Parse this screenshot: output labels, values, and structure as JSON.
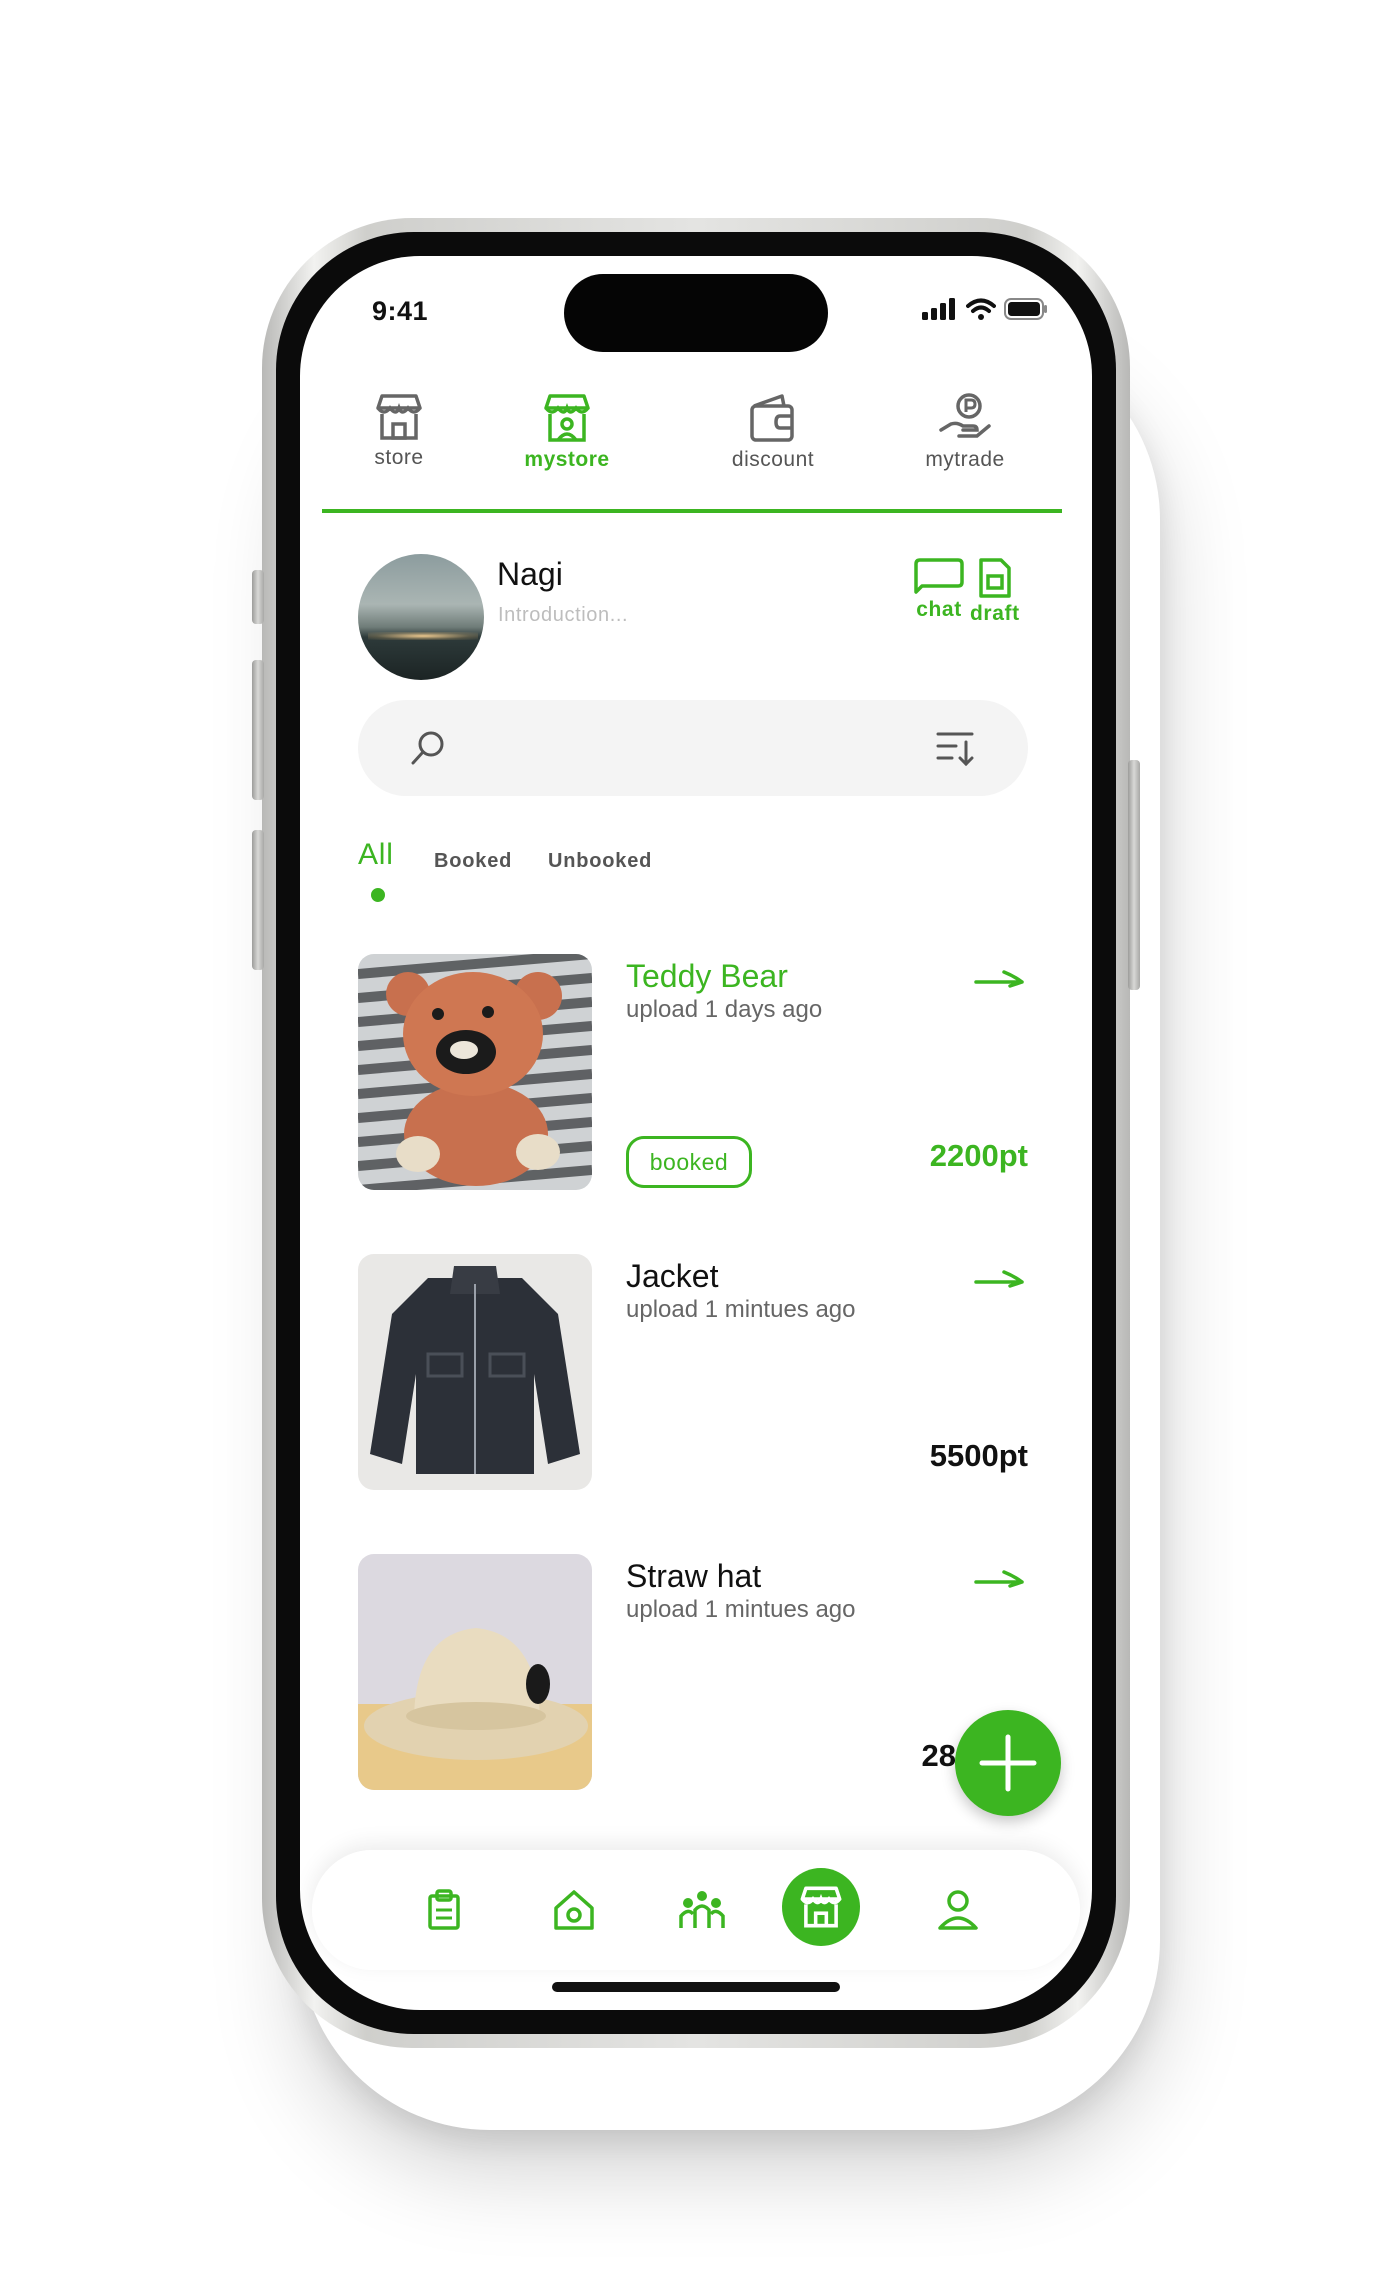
{
  "status_bar": {
    "time": "9:41"
  },
  "top_nav": {
    "items": [
      {
        "label": "store",
        "icon": "store-icon",
        "active": false
      },
      {
        "label": "mystore",
        "icon": "mystore-icon",
        "active": true
      },
      {
        "label": "discount",
        "icon": "wallet-icon",
        "active": false
      },
      {
        "label": "mytrade",
        "icon": "hand-coin-icon",
        "active": false
      }
    ]
  },
  "profile": {
    "name": "Nagi",
    "intro_placeholder": "Introduction...",
    "actions": [
      {
        "label": "chat",
        "icon": "chat-icon"
      },
      {
        "label": "draft",
        "icon": "draft-icon"
      }
    ]
  },
  "search": {
    "icon": "search-icon",
    "sort_icon": "sort-icon"
  },
  "filter_tabs": [
    {
      "label": "All",
      "active": true
    },
    {
      "label": "Booked",
      "active": false
    },
    {
      "label": "Unbooked",
      "active": false
    }
  ],
  "products": [
    {
      "title": "Teddy Bear",
      "subtitle": "upload 1 days ago",
      "price": "2200pt",
      "badge": "booked",
      "booked": true
    },
    {
      "title": "Jacket",
      "subtitle": "upload 1 mintues ago",
      "price": "5500pt",
      "badge": "",
      "booked": false
    },
    {
      "title": "Straw hat",
      "subtitle": "upload 1 mintues ago",
      "price": "28",
      "badge": "",
      "booked": false
    }
  ],
  "bottom_nav": {
    "items": [
      {
        "icon": "clipboard-icon",
        "active": false
      },
      {
        "icon": "home-icon",
        "active": false
      },
      {
        "icon": "community-icon",
        "active": false
      },
      {
        "icon": "store-icon",
        "active": true
      },
      {
        "icon": "profile-icon",
        "active": false
      }
    ]
  },
  "colors": {
    "accent": "#3cb521",
    "text": "#111111",
    "muted": "#666666",
    "search_bg": "#f4f4f4"
  }
}
